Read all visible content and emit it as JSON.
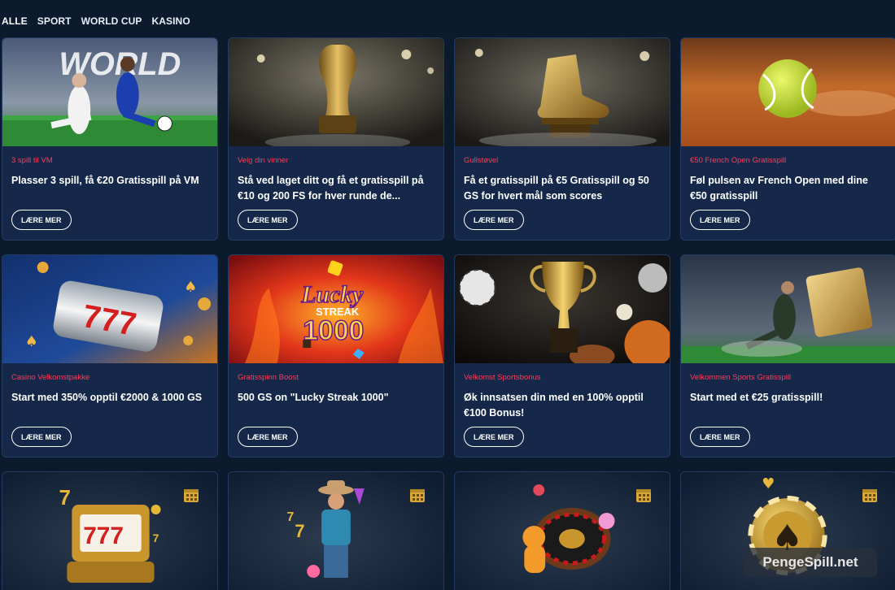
{
  "tabs": [
    "ALLE",
    "SPORT",
    "WORLD CUP",
    "KASINO"
  ],
  "cards": [
    {
      "tag": "3 spill til VM",
      "title": "Plasser 3 spill, få €20 Gratisspill på VM",
      "button": "LÆRE MER",
      "image": "world-cup-football-players"
    },
    {
      "tag": "Velg din vinner",
      "title": "Stå ved laget ditt og få et gratisspill på €10 og 200 FS for hver runde de...",
      "button": "LÆRE MER",
      "image": "golden-trophy-stadium"
    },
    {
      "tag": "Gullstøvel",
      "title": "Få et gratisspill på €5 Gratisspill og 50 GS for hvert mål som scores",
      "button": "LÆRE MER",
      "image": "golden-boot"
    },
    {
      "tag": "€50 French Open Gratisspill",
      "title": "Føl pulsen av French Open med dine €50 gratisspill",
      "button": "LÆRE MER",
      "image": "tennis-ball-clay"
    },
    {
      "tag": "Casino Velkomstpakke",
      "title": "Start med 350% opptil €2000 & 1000 GS",
      "button": "LÆRE MER",
      "image": "slot-reel-777"
    },
    {
      "tag": "Gratisspinn Boost",
      "title": "500 GS on \"Lucky Streak 1000\"",
      "button": "LÆRE MER",
      "image": "lucky-streak-1000"
    },
    {
      "tag": "Velkomst Sportsbonus",
      "title": "Øk innsatsen din med en 100% opptil €100 Bonus!",
      "button": "LÆRE MER",
      "image": "trophy-sports-balls"
    },
    {
      "tag": "Velkommen Sports Gratisspill",
      "title": "Start med et €25 gratisspill!",
      "button": "LÆRE MER",
      "image": "football-player-ticket"
    }
  ],
  "small_cards": [
    {
      "image": "golden-slot-machine",
      "icon": "calendar-icon"
    },
    {
      "image": "cowboy-character",
      "icon": "calendar-icon"
    },
    {
      "image": "roulette-wheel",
      "icon": "calendar-icon"
    },
    {
      "image": "poker-chip-spade",
      "icon": "calendar-icon"
    }
  ],
  "images": {
    "lucky_text": "Lucky",
    "streak_text": "STREAK",
    "thousand_text": "1000",
    "world_text": "WORLD",
    "slot_digits": "777"
  },
  "watermark": "PengeSpill.net",
  "colors": {
    "background": "#0c1a2e",
    "card": "#15284a",
    "tag": "#ff3b56",
    "button_border": "#ffffff"
  }
}
